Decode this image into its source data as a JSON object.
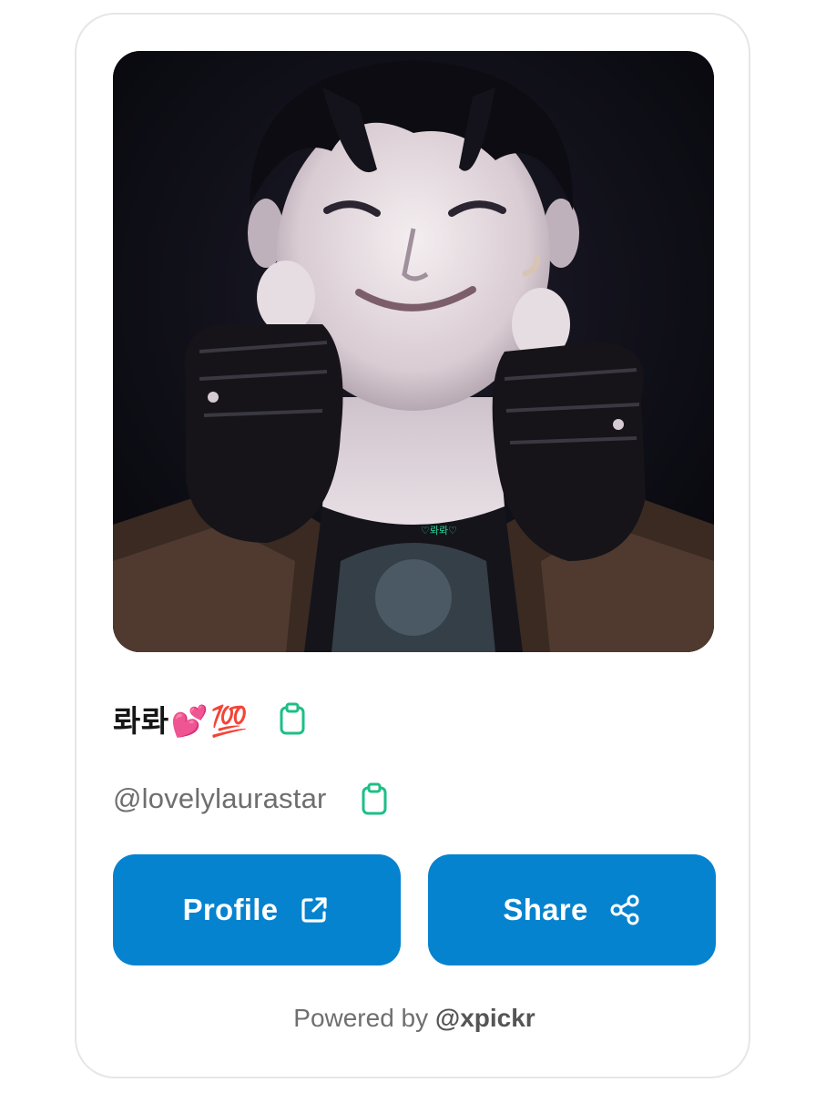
{
  "profile": {
    "display_name": "롸롸",
    "display_name_emoji_1": "💕",
    "display_name_emoji_2": "💯",
    "handle": "@lovelylaurastar",
    "photo_caption": "♡롸롸♡"
  },
  "icons": {
    "copy_name": "clipboard-icon",
    "copy_handle": "clipboard-icon",
    "external_link": "external-link-icon",
    "share": "share-icon"
  },
  "buttons": {
    "profile_label": "Profile",
    "share_label": "Share"
  },
  "footer": {
    "powered_prefix": "Powered by ",
    "powered_brand": "@xpickr"
  },
  "colors": {
    "accent": "#0683cf",
    "copy_icon": "#1dbf86",
    "handle_text": "#6e6e6e",
    "card_border": "#e6e6e6"
  }
}
